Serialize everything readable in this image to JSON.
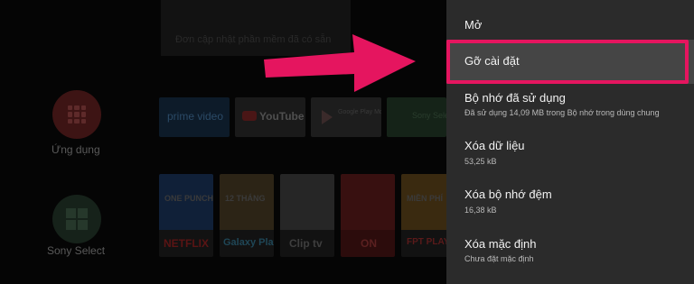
{
  "background": {
    "notice_text": "Đơn cập nhật phần mềm đã có sẵn",
    "apps_label": "Ứng dụng",
    "sony_label": "Sony Select",
    "app_tiles": [
      {
        "name": "prime video",
        "icon": "prime-video-logo"
      },
      {
        "name": "YouTube",
        "icon": "youtube-play-icon"
      },
      {
        "name": "Google Play Movies",
        "icon": "google-play-icon"
      },
      {
        "name": "Sony Select",
        "icon": "green-app-icon"
      }
    ],
    "posters": [
      {
        "caption": "NETFLIX",
        "art": "ONE PUNCH MAN"
      },
      {
        "caption": "Galaxy Play",
        "art": "12 THÁNG"
      },
      {
        "caption": "Clip tv",
        "art": ""
      },
      {
        "caption": "ON",
        "art": ""
      },
      {
        "caption": "FPT PLAY",
        "art": "MIỀN PHÍ"
      }
    ]
  },
  "menu": {
    "items": [
      {
        "id": "open",
        "title": "Mở",
        "subtitle": ""
      },
      {
        "id": "uninstall",
        "title": "Gỡ cài đặt",
        "subtitle": "",
        "focused": true
      },
      {
        "id": "storage",
        "title": "Bộ nhớ đã sử dụng",
        "subtitle": "Đã sử dụng 14,09 MB trong Bộ nhớ trong dùng chung"
      },
      {
        "id": "clear_data",
        "title": "Xóa dữ liệu",
        "subtitle": "53,25 kB"
      },
      {
        "id": "clear_cache",
        "title": "Xóa bộ nhớ đệm",
        "subtitle": "16,38 kB"
      },
      {
        "id": "clear_defaults",
        "title": "Xóa mặc định",
        "subtitle": "Chưa đặt mặc định"
      }
    ]
  },
  "colors": {
    "highlight": "#e5155f",
    "panel_bg": "#2b2b2b",
    "focus_bg": "#454545",
    "arrow": "#e5155f"
  }
}
